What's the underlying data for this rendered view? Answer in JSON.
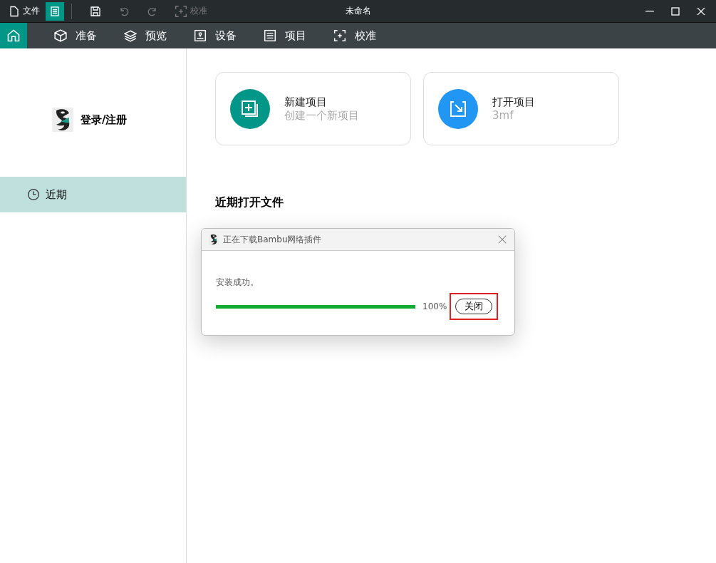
{
  "title_bar": {
    "file_label": "文件",
    "menu_active": true,
    "calibrate_label": "校准",
    "calibrate_disabled": true,
    "title": "未命名"
  },
  "nav_tabs": [
    {
      "kind": "home",
      "selected": true
    },
    {
      "kind": "prepare",
      "label": "准备",
      "selected": false
    },
    {
      "kind": "preview",
      "label": "预览",
      "selected": false
    },
    {
      "kind": "device",
      "label": "设备",
      "selected": false
    },
    {
      "kind": "project",
      "label": "项目",
      "selected": false
    },
    {
      "kind": "calibrate",
      "label": "校准",
      "selected": false
    }
  ],
  "sidebar": {
    "login": "登录/注册",
    "items": [
      {
        "label": "近期",
        "selected": true
      }
    ]
  },
  "cards": [
    {
      "kind": "new",
      "title": "新建项目",
      "subtitle": "创建一个新项目",
      "color": "#009688"
    },
    {
      "kind": "open",
      "title": "打开项目",
      "subtitle": "3mf",
      "color": "#2196f3"
    }
  ],
  "recent_heading": "近期打开文件",
  "dialog": {
    "title": "正在下载Bambu网络插件",
    "message": "安装成功。",
    "level": 1,
    "reading": "100%",
    "close_label": "关闭",
    "close_highlighted": true
  }
}
